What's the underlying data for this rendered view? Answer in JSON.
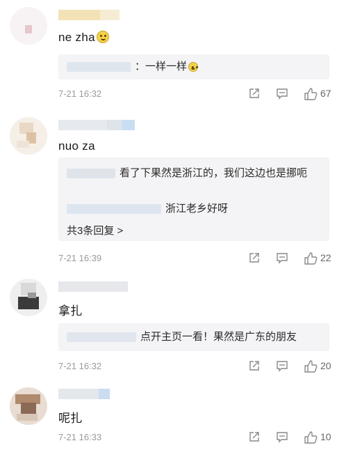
{
  "comments": [
    {
      "body": "ne zha",
      "reply": {
        "text": "：一样一样"
      },
      "time": "7-21 16:32",
      "likes": "67"
    },
    {
      "body": "nuo za",
      "replies": [
        {
          "text": "看了下果然是浙江的，我们这边也是挪呃"
        },
        {
          "text": "浙江老乡好呀"
        }
      ],
      "more": "共3条回复 >",
      "time": "7-21 16:39",
      "likes": "22"
    },
    {
      "body": "拿扎",
      "reply": {
        "text": "点开主页一看！果然是广东的朋友"
      },
      "time": "7-21 16:32",
      "likes": "20"
    },
    {
      "body": "呢扎",
      "time": "7-21 16:33",
      "likes": "10"
    }
  ],
  "icons": {
    "share": "share-icon",
    "comment": "comment-icon",
    "like": "thumbs-up-icon",
    "emoji": "laughing-emoji-icon"
  },
  "colors": {
    "background": "#ffffff",
    "reply_bg": "#f4f4f6",
    "meta": "#9a9a9a"
  }
}
